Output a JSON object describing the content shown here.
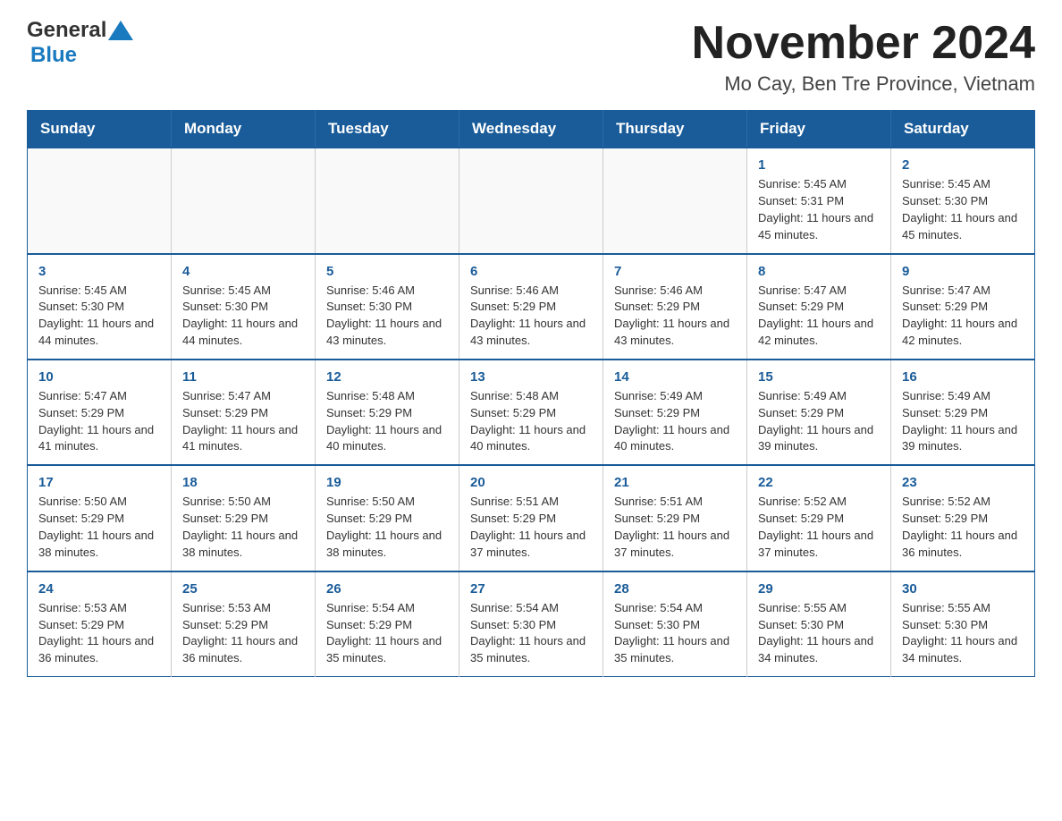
{
  "header": {
    "title": "November 2024",
    "subtitle": "Mo Cay, Ben Tre Province, Vietnam"
  },
  "logo": {
    "general": "General",
    "blue": "Blue"
  },
  "days_of_week": [
    "Sunday",
    "Monday",
    "Tuesday",
    "Wednesday",
    "Thursday",
    "Friday",
    "Saturday"
  ],
  "weeks": [
    {
      "days": [
        {
          "number": "",
          "info": "",
          "empty": true
        },
        {
          "number": "",
          "info": "",
          "empty": true
        },
        {
          "number": "",
          "info": "",
          "empty": true
        },
        {
          "number": "",
          "info": "",
          "empty": true
        },
        {
          "number": "",
          "info": "",
          "empty": true
        },
        {
          "number": "1",
          "info": "Sunrise: 5:45 AM\nSunset: 5:31 PM\nDaylight: 11 hours and 45 minutes."
        },
        {
          "number": "2",
          "info": "Sunrise: 5:45 AM\nSunset: 5:30 PM\nDaylight: 11 hours and 45 minutes."
        }
      ]
    },
    {
      "days": [
        {
          "number": "3",
          "info": "Sunrise: 5:45 AM\nSunset: 5:30 PM\nDaylight: 11 hours and 44 minutes."
        },
        {
          "number": "4",
          "info": "Sunrise: 5:45 AM\nSunset: 5:30 PM\nDaylight: 11 hours and 44 minutes."
        },
        {
          "number": "5",
          "info": "Sunrise: 5:46 AM\nSunset: 5:30 PM\nDaylight: 11 hours and 43 minutes."
        },
        {
          "number": "6",
          "info": "Sunrise: 5:46 AM\nSunset: 5:29 PM\nDaylight: 11 hours and 43 minutes."
        },
        {
          "number": "7",
          "info": "Sunrise: 5:46 AM\nSunset: 5:29 PM\nDaylight: 11 hours and 43 minutes."
        },
        {
          "number": "8",
          "info": "Sunrise: 5:47 AM\nSunset: 5:29 PM\nDaylight: 11 hours and 42 minutes."
        },
        {
          "number": "9",
          "info": "Sunrise: 5:47 AM\nSunset: 5:29 PM\nDaylight: 11 hours and 42 minutes."
        }
      ]
    },
    {
      "days": [
        {
          "number": "10",
          "info": "Sunrise: 5:47 AM\nSunset: 5:29 PM\nDaylight: 11 hours and 41 minutes."
        },
        {
          "number": "11",
          "info": "Sunrise: 5:47 AM\nSunset: 5:29 PM\nDaylight: 11 hours and 41 minutes."
        },
        {
          "number": "12",
          "info": "Sunrise: 5:48 AM\nSunset: 5:29 PM\nDaylight: 11 hours and 40 minutes."
        },
        {
          "number": "13",
          "info": "Sunrise: 5:48 AM\nSunset: 5:29 PM\nDaylight: 11 hours and 40 minutes."
        },
        {
          "number": "14",
          "info": "Sunrise: 5:49 AM\nSunset: 5:29 PM\nDaylight: 11 hours and 40 minutes."
        },
        {
          "number": "15",
          "info": "Sunrise: 5:49 AM\nSunset: 5:29 PM\nDaylight: 11 hours and 39 minutes."
        },
        {
          "number": "16",
          "info": "Sunrise: 5:49 AM\nSunset: 5:29 PM\nDaylight: 11 hours and 39 minutes."
        }
      ]
    },
    {
      "days": [
        {
          "number": "17",
          "info": "Sunrise: 5:50 AM\nSunset: 5:29 PM\nDaylight: 11 hours and 38 minutes."
        },
        {
          "number": "18",
          "info": "Sunrise: 5:50 AM\nSunset: 5:29 PM\nDaylight: 11 hours and 38 minutes."
        },
        {
          "number": "19",
          "info": "Sunrise: 5:50 AM\nSunset: 5:29 PM\nDaylight: 11 hours and 38 minutes."
        },
        {
          "number": "20",
          "info": "Sunrise: 5:51 AM\nSunset: 5:29 PM\nDaylight: 11 hours and 37 minutes."
        },
        {
          "number": "21",
          "info": "Sunrise: 5:51 AM\nSunset: 5:29 PM\nDaylight: 11 hours and 37 minutes."
        },
        {
          "number": "22",
          "info": "Sunrise: 5:52 AM\nSunset: 5:29 PM\nDaylight: 11 hours and 37 minutes."
        },
        {
          "number": "23",
          "info": "Sunrise: 5:52 AM\nSunset: 5:29 PM\nDaylight: 11 hours and 36 minutes."
        }
      ]
    },
    {
      "days": [
        {
          "number": "24",
          "info": "Sunrise: 5:53 AM\nSunset: 5:29 PM\nDaylight: 11 hours and 36 minutes."
        },
        {
          "number": "25",
          "info": "Sunrise: 5:53 AM\nSunset: 5:29 PM\nDaylight: 11 hours and 36 minutes."
        },
        {
          "number": "26",
          "info": "Sunrise: 5:54 AM\nSunset: 5:29 PM\nDaylight: 11 hours and 35 minutes."
        },
        {
          "number": "27",
          "info": "Sunrise: 5:54 AM\nSunset: 5:30 PM\nDaylight: 11 hours and 35 minutes."
        },
        {
          "number": "28",
          "info": "Sunrise: 5:54 AM\nSunset: 5:30 PM\nDaylight: 11 hours and 35 minutes."
        },
        {
          "number": "29",
          "info": "Sunrise: 5:55 AM\nSunset: 5:30 PM\nDaylight: 11 hours and 34 minutes."
        },
        {
          "number": "30",
          "info": "Sunrise: 5:55 AM\nSunset: 5:30 PM\nDaylight: 11 hours and 34 minutes."
        }
      ]
    }
  ]
}
